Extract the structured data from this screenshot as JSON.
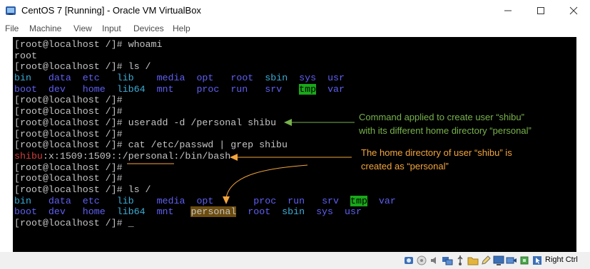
{
  "window": {
    "title": "CentOS 7 [Running] - Oracle VM VirtualBox",
    "controls": [
      "minimize",
      "maximize",
      "close"
    ]
  },
  "menu": [
    "File",
    "Machine",
    "View",
    "Input",
    "Devices",
    "Help"
  ],
  "terminal": {
    "lines": [
      [
        {
          "t": "[root@localhost /]# whoami",
          "c": "w"
        }
      ],
      [
        {
          "t": "root",
          "c": "w"
        }
      ],
      [
        {
          "t": "[root@localhost /]# ls /",
          "c": "w"
        }
      ],
      [
        {
          "t": "bin",
          "c": "c"
        },
        {
          "t": "   ",
          "c": "w"
        },
        {
          "t": "data",
          "c": "b"
        },
        {
          "t": "  ",
          "c": "w"
        },
        {
          "t": "etc",
          "c": "b"
        },
        {
          "t": "   ",
          "c": "w"
        },
        {
          "t": "lib",
          "c": "c"
        },
        {
          "t": "    ",
          "c": "w"
        },
        {
          "t": "media",
          "c": "b"
        },
        {
          "t": "  ",
          "c": "w"
        },
        {
          "t": "opt",
          "c": "b"
        },
        {
          "t": "   ",
          "c": "w"
        },
        {
          "t": "root",
          "c": "b"
        },
        {
          "t": "  ",
          "c": "w"
        },
        {
          "t": "sbin",
          "c": "c"
        },
        {
          "t": "  ",
          "c": "w"
        },
        {
          "t": "sys",
          "c": "b"
        },
        {
          "t": "  ",
          "c": "w"
        },
        {
          "t": "usr",
          "c": "b"
        }
      ],
      [
        {
          "t": "boot",
          "c": "b"
        },
        {
          "t": "  ",
          "c": "w"
        },
        {
          "t": "dev",
          "c": "b"
        },
        {
          "t": "   ",
          "c": "w"
        },
        {
          "t": "home",
          "c": "b"
        },
        {
          "t": "  ",
          "c": "w"
        },
        {
          "t": "lib64",
          "c": "c"
        },
        {
          "t": "  ",
          "c": "w"
        },
        {
          "t": "mnt",
          "c": "b"
        },
        {
          "t": "    ",
          "c": "w"
        },
        {
          "t": "proc",
          "c": "b"
        },
        {
          "t": "  ",
          "c": "w"
        },
        {
          "t": "run",
          "c": "b"
        },
        {
          "t": "   ",
          "c": "w"
        },
        {
          "t": "srv",
          "c": "b"
        },
        {
          "t": "   ",
          "c": "w"
        },
        {
          "t": "tmp",
          "c": "g"
        },
        {
          "t": "  ",
          "c": "w"
        },
        {
          "t": "var",
          "c": "b"
        }
      ],
      [
        {
          "t": "[root@localhost /]#",
          "c": "w"
        }
      ],
      [
        {
          "t": "[root@localhost /]#",
          "c": "w"
        }
      ],
      [
        {
          "t": "[root@localhost /]# useradd -d /personal shibu",
          "c": "w"
        }
      ],
      [
        {
          "t": "[root@localhost /]#",
          "c": "w"
        }
      ],
      [
        {
          "t": "[root@localhost /]# cat /etc/passwd | grep shibu",
          "c": "w"
        }
      ],
      [
        {
          "t": "shibu",
          "c": "r"
        },
        {
          "t": ":x:1509:1509::/personal:/bin/bash",
          "c": "w"
        }
      ],
      [
        {
          "t": "[root@localhost /]#",
          "c": "w"
        }
      ],
      [
        {
          "t": "[root@localhost /]#",
          "c": "w"
        }
      ],
      [
        {
          "t": "[root@localhost /]# ls /",
          "c": "w"
        }
      ],
      [
        {
          "t": "bin",
          "c": "c"
        },
        {
          "t": "   ",
          "c": "w"
        },
        {
          "t": "data",
          "c": "b"
        },
        {
          "t": "  ",
          "c": "w"
        },
        {
          "t": "etc",
          "c": "b"
        },
        {
          "t": "   ",
          "c": "w"
        },
        {
          "t": "lib",
          "c": "c"
        },
        {
          "t": "    ",
          "c": "w"
        },
        {
          "t": "media",
          "c": "b"
        },
        {
          "t": "  ",
          "c": "w"
        },
        {
          "t": "opt",
          "c": "b"
        },
        {
          "t": "       ",
          "c": "w"
        },
        {
          "t": "proc",
          "c": "b"
        },
        {
          "t": "  ",
          "c": "w"
        },
        {
          "t": "run",
          "c": "b"
        },
        {
          "t": "   ",
          "c": "w"
        },
        {
          "t": "srv",
          "c": "b"
        },
        {
          "t": "  ",
          "c": "w"
        },
        {
          "t": "tmp",
          "c": "g"
        },
        {
          "t": "  ",
          "c": "w"
        },
        {
          "t": "var",
          "c": "b"
        }
      ],
      [
        {
          "t": "boot",
          "c": "b"
        },
        {
          "t": "  ",
          "c": "w"
        },
        {
          "t": "dev",
          "c": "b"
        },
        {
          "t": "   ",
          "c": "w"
        },
        {
          "t": "home",
          "c": "b"
        },
        {
          "t": "  ",
          "c": "w"
        },
        {
          "t": "lib64",
          "c": "c"
        },
        {
          "t": "  ",
          "c": "w"
        },
        {
          "t": "mnt",
          "c": "b"
        },
        {
          "t": "   ",
          "c": "w"
        },
        {
          "t": "personal",
          "c": "h"
        },
        {
          "t": "  ",
          "c": "w"
        },
        {
          "t": "root",
          "c": "b"
        },
        {
          "t": "  ",
          "c": "w"
        },
        {
          "t": "sbin",
          "c": "c"
        },
        {
          "t": "  ",
          "c": "w"
        },
        {
          "t": "sys",
          "c": "b"
        },
        {
          "t": "  ",
          "c": "w"
        },
        {
          "t": "usr",
          "c": "b"
        }
      ],
      [
        {
          "t": "[root@localhost /]# ",
          "c": "w"
        },
        {
          "t": "_",
          "c": "cur"
        }
      ]
    ]
  },
  "annotations": {
    "command_note": [
      "Command  applied to create user “shibu”",
      "with its different home directory  “personal”"
    ],
    "home_note": [
      "The home directory of user “shibu” is",
      "created as “personal”"
    ]
  },
  "status_bar": {
    "icons": [
      "hard-disk-icon",
      "optical-drive-icon",
      "audio-icon",
      "network-icon",
      "usb-icon",
      "shared-folders-icon",
      "pencil-icon",
      "display-icon",
      "video-capture-icon",
      "cpu-icon",
      "mouse-integration-icon",
      "keyboard-capture-icon"
    ],
    "host_key": "Right Ctrl"
  },
  "colors": {
    "terminal_bg": "#000000",
    "terminal_text": "#c4c4c4",
    "terminal_blue": "#5f5ff5",
    "terminal_cyan": "#3aaed8",
    "terminal_red": "#d23f3f",
    "terminal_green_highlight": "#18a918",
    "annotation_green": "#77b24a",
    "annotation_orange": "#f3a53c"
  }
}
